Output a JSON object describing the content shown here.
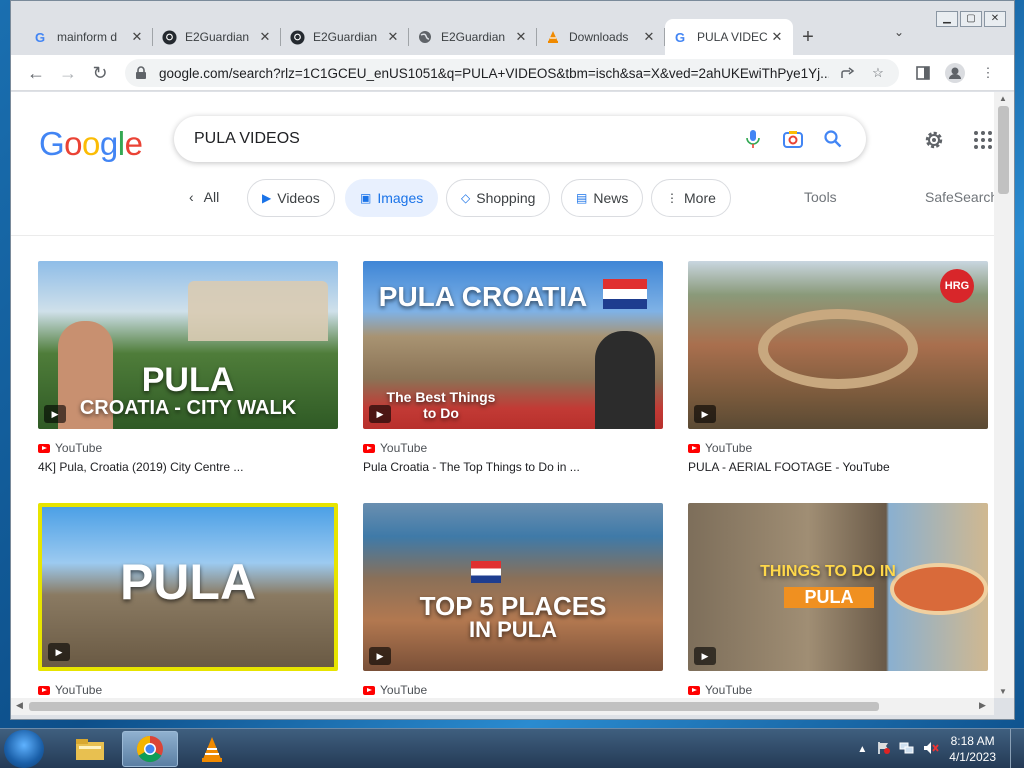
{
  "tabs": [
    {
      "title": "mainform d",
      "icon": "google-icon"
    },
    {
      "title": "E2Guardian",
      "icon": "github-icon"
    },
    {
      "title": "E2Guardian",
      "icon": "github-icon"
    },
    {
      "title": "E2Guardian",
      "icon": "globe-icon"
    },
    {
      "title": "Downloads",
      "icon": "vlc-icon"
    },
    {
      "title": "PULA VIDEC",
      "icon": "google-icon",
      "active": true
    }
  ],
  "toolbar": {
    "url": "google.com/search?rlz=1C1GCEU_enUS1051&q=PULA+VIDEOS&tbm=isch&sa=X&ved=2ahUKEwiThPye1Yj..."
  },
  "search": {
    "query": "PULA VIDEOS"
  },
  "filters": [
    "All",
    "Videos",
    "Images",
    "Shopping",
    "News",
    "More",
    "Tools",
    "SafeSearch"
  ],
  "active_filter": "Images",
  "results": [
    {
      "source": "YouTube",
      "title": "4K] Pula, Croatia (2019) City Centre ...",
      "caption1": "PULA",
      "caption2": "CROATIA - CITY WALK"
    },
    {
      "source": "YouTube",
      "title": "Pula Croatia - The Top Things to Do in ...",
      "caption1": "PULA CROATIA",
      "caption2": "The Best Things to Do"
    },
    {
      "source": "YouTube",
      "title": "PULA - AERIAL FOOTAGE - YouTube",
      "logo": "HRG"
    },
    {
      "source": "YouTube",
      "caption1": "PULA"
    },
    {
      "source": "YouTube",
      "caption1": "TOP 5 PLACES",
      "caption2": "IN PULA"
    },
    {
      "source": "YouTube",
      "caption1": "THINGS TO DO IN",
      "caption2": "PULA"
    }
  ],
  "taskbar": {
    "time": "8:18 AM",
    "date": "4/1/2023",
    "pinned": [
      "file-explorer",
      "chrome",
      "vlc"
    ]
  },
  "colors": {
    "accent": "#1a73e8",
    "chip_active_bg": "#e8f0fe",
    "youtube_red": "#ff0000"
  }
}
